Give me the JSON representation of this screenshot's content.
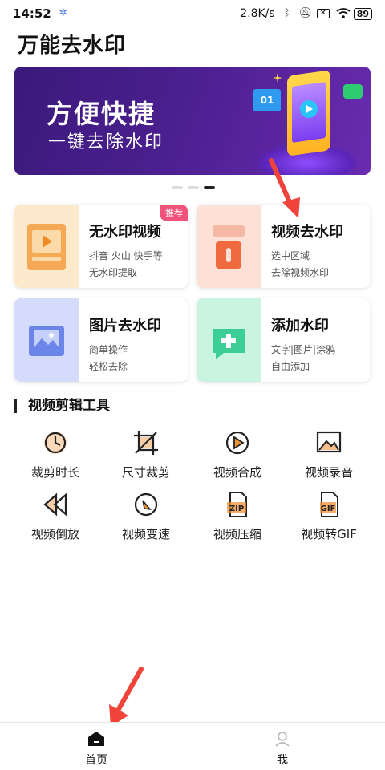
{
  "status_bar": {
    "time": "14:52",
    "network_speed": "2.8K/s",
    "battery": "89"
  },
  "app": {
    "title": "万能去水印"
  },
  "banner": {
    "title": "方便快捷",
    "subtitle": "一键去除水印",
    "card_label": "01",
    "page_count": 3,
    "active_page": 3
  },
  "features": [
    {
      "title": "无水印视频",
      "line1": "抖音 火山 快手等",
      "line2": "无水印提取",
      "badge": "推荐",
      "color": "#fde9cc"
    },
    {
      "title": "视频去水印",
      "line1": "选中区域",
      "line2": "去除视频水印",
      "color": "#fde0d6"
    },
    {
      "title": "图片去水印",
      "line1": "简单操作",
      "line2": "轻松去除",
      "color": "#d5dcfb"
    },
    {
      "title": "添加水印",
      "line1": "文字|图片|涂鸦",
      "line2": "自由添加",
      "color": "#c9f4e0"
    }
  ],
  "tools": {
    "section_title": "视频剪辑工具",
    "items": [
      {
        "label": "裁剪时长",
        "icon": "clock-cut-icon"
      },
      {
        "label": "尺寸裁剪",
        "icon": "crop-icon"
      },
      {
        "label": "视频合成",
        "icon": "play-circle-icon"
      },
      {
        "label": "视频录音",
        "icon": "image-audio-icon"
      },
      {
        "label": "视频倒放",
        "icon": "rewind-icon"
      },
      {
        "label": "视频变速",
        "icon": "speed-icon"
      },
      {
        "label": "视频压缩",
        "icon": "zip-icon"
      },
      {
        "label": "视频转GIF",
        "icon": "gif-icon"
      }
    ]
  },
  "bottom_nav": {
    "home": "首页",
    "me": "我"
  },
  "colors": {
    "accent": "#f0923a",
    "arrow": "#f0433a"
  }
}
